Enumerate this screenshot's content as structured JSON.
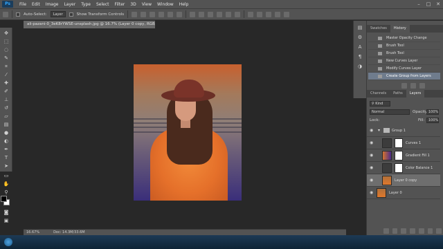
{
  "app": {
    "logo": "Ps"
  },
  "menu": [
    "File",
    "Edit",
    "Image",
    "Layer",
    "Type",
    "Select",
    "Filter",
    "3D",
    "View",
    "Window",
    "Help"
  ],
  "window_controls": {
    "minimize": "–",
    "maximize": "□",
    "close": "✕"
  },
  "options_bar": {
    "auto_select_label": "Auto-Select:",
    "auto_select_value": "Layer",
    "show_transform_label": "Show Transform Controls"
  },
  "document": {
    "tab_title": "ali-pazani-0_3eK8rYWSE-unsplash.jpg @ 16.7% (Layer 0 copy, RGB/8) *",
    "zoom": "16.67%",
    "doc_size": "Doc: 14.3M/33.6M"
  },
  "history_panel": {
    "tabs": [
      "Swatches",
      "History"
    ],
    "active_tab": "History",
    "items": [
      {
        "label": "Master Opacity Change"
      },
      {
        "label": "Brush Tool"
      },
      {
        "label": "Brush Tool"
      },
      {
        "label": "New Curves Layer"
      },
      {
        "label": "Modify Curves Layer"
      },
      {
        "label": "Create Group from Layers"
      }
    ],
    "selected_index": 5
  },
  "layers_panel": {
    "tabs": [
      "Channels",
      "Paths",
      "Layers"
    ],
    "active_tab": "Layers",
    "kind_label": "Kind",
    "blend_mode": "Normal",
    "opacity_label": "Opacity:",
    "opacity_value": "100%",
    "lock_label": "Lock:",
    "fill_label": "Fill:",
    "fill_value": "100%",
    "layers": [
      {
        "name": "Group 1",
        "type": "group"
      },
      {
        "name": "Curves 1",
        "type": "adjustment"
      },
      {
        "name": "Gradient Fill 1",
        "type": "fill"
      },
      {
        "name": "Color Balance 1",
        "type": "adjustment"
      },
      {
        "name": "Layer 0 copy",
        "type": "pixel",
        "selected": true
      },
      {
        "name": "Layer 0",
        "type": "pixel"
      }
    ]
  },
  "colors": {
    "ui_bg": "#535353",
    "canvas_bg": "#282828",
    "selection": "#6f7c8d",
    "ps_blue": "#31a8ff"
  }
}
